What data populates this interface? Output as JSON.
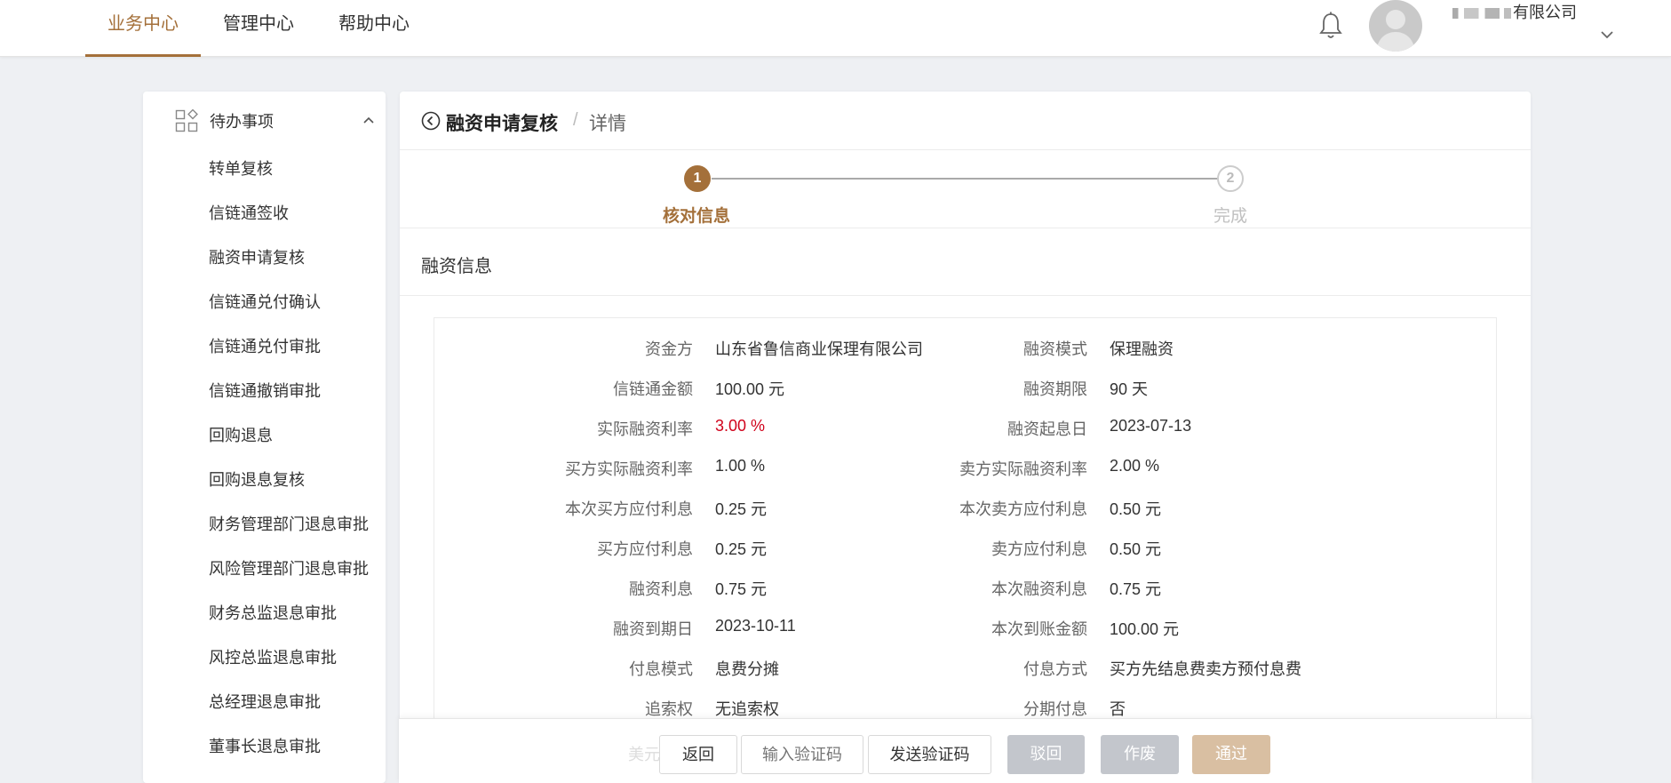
{
  "header": {
    "nav": [
      "业务中心",
      "管理中心",
      "帮助中心"
    ],
    "active_index": 0,
    "company": "有限公司",
    "accent_color": "#a4703a"
  },
  "sidebar": {
    "group_title": "待办事项",
    "items": [
      "转单复核",
      "信链通签收",
      "融资申请复核",
      "信链通兑付确认",
      "信链通兑付审批",
      "信链通撤销审批",
      "回购退息",
      "回购退息复核",
      "财务管理部门退息审批",
      "风险管理部门退息审批",
      "财务总监退息审批",
      "风控总监退息审批",
      "总经理退息审批",
      "董事长退息审批"
    ]
  },
  "breadcrumb": {
    "title": "融资申请复核",
    "separator": "/",
    "current": "详情"
  },
  "steps": [
    {
      "number": "1",
      "label": "核对信息",
      "state": "active"
    },
    {
      "number": "2",
      "label": "完成",
      "state": "pending"
    }
  ],
  "section": {
    "title": "融资信息"
  },
  "info": {
    "rows": [
      {
        "l_label": "资金方",
        "l_value": "山东省鲁信商业保理有限公司",
        "r_label": "融资模式",
        "r_value": "保理融资"
      },
      {
        "l_label": "信链通金额",
        "l_value": "100.00 元",
        "r_label": "融资期限",
        "r_value": "90 天"
      },
      {
        "l_label": "实际融资利率",
        "l_value": "3.00 %",
        "r_label": "融资起息日",
        "r_value": "2023-07-13"
      },
      {
        "l_label": "买方实际融资利率",
        "l_value": "1.00 %",
        "r_label": "卖方实际融资利率",
        "r_value": "2.00 %"
      },
      {
        "l_label": "本次买方应付利息",
        "l_value": "0.25 元",
        "r_label": "本次卖方应付利息",
        "r_value": "0.50 元"
      },
      {
        "l_label": "买方应付利息",
        "l_value": "0.25 元",
        "r_label": "卖方应付利息",
        "r_value": "0.50 元"
      },
      {
        "l_label": "融资利息",
        "l_value": "0.75 元",
        "r_label": "本次融资利息",
        "r_value": "0.75 元"
      },
      {
        "l_label": "融资到期日",
        "l_value": "2023-10-11",
        "r_label": "本次到账金额",
        "r_value": "100.00 元"
      },
      {
        "l_label": "付息模式",
        "l_value": "息费分摊",
        "r_label": "付息方式",
        "r_value": "买方先结息费卖方预付息费"
      },
      {
        "l_label": "追索权",
        "l_value": "无追索权",
        "r_label": "分期付息",
        "r_value": "否"
      }
    ],
    "highlight_color": "#d0021b"
  },
  "footer": {
    "ghost_label": "美元",
    "back": "返回",
    "code_placeholder": "输入验证码",
    "send_code": "发送验证码",
    "reject": "驳回",
    "void": "作废",
    "pass": "通过"
  }
}
